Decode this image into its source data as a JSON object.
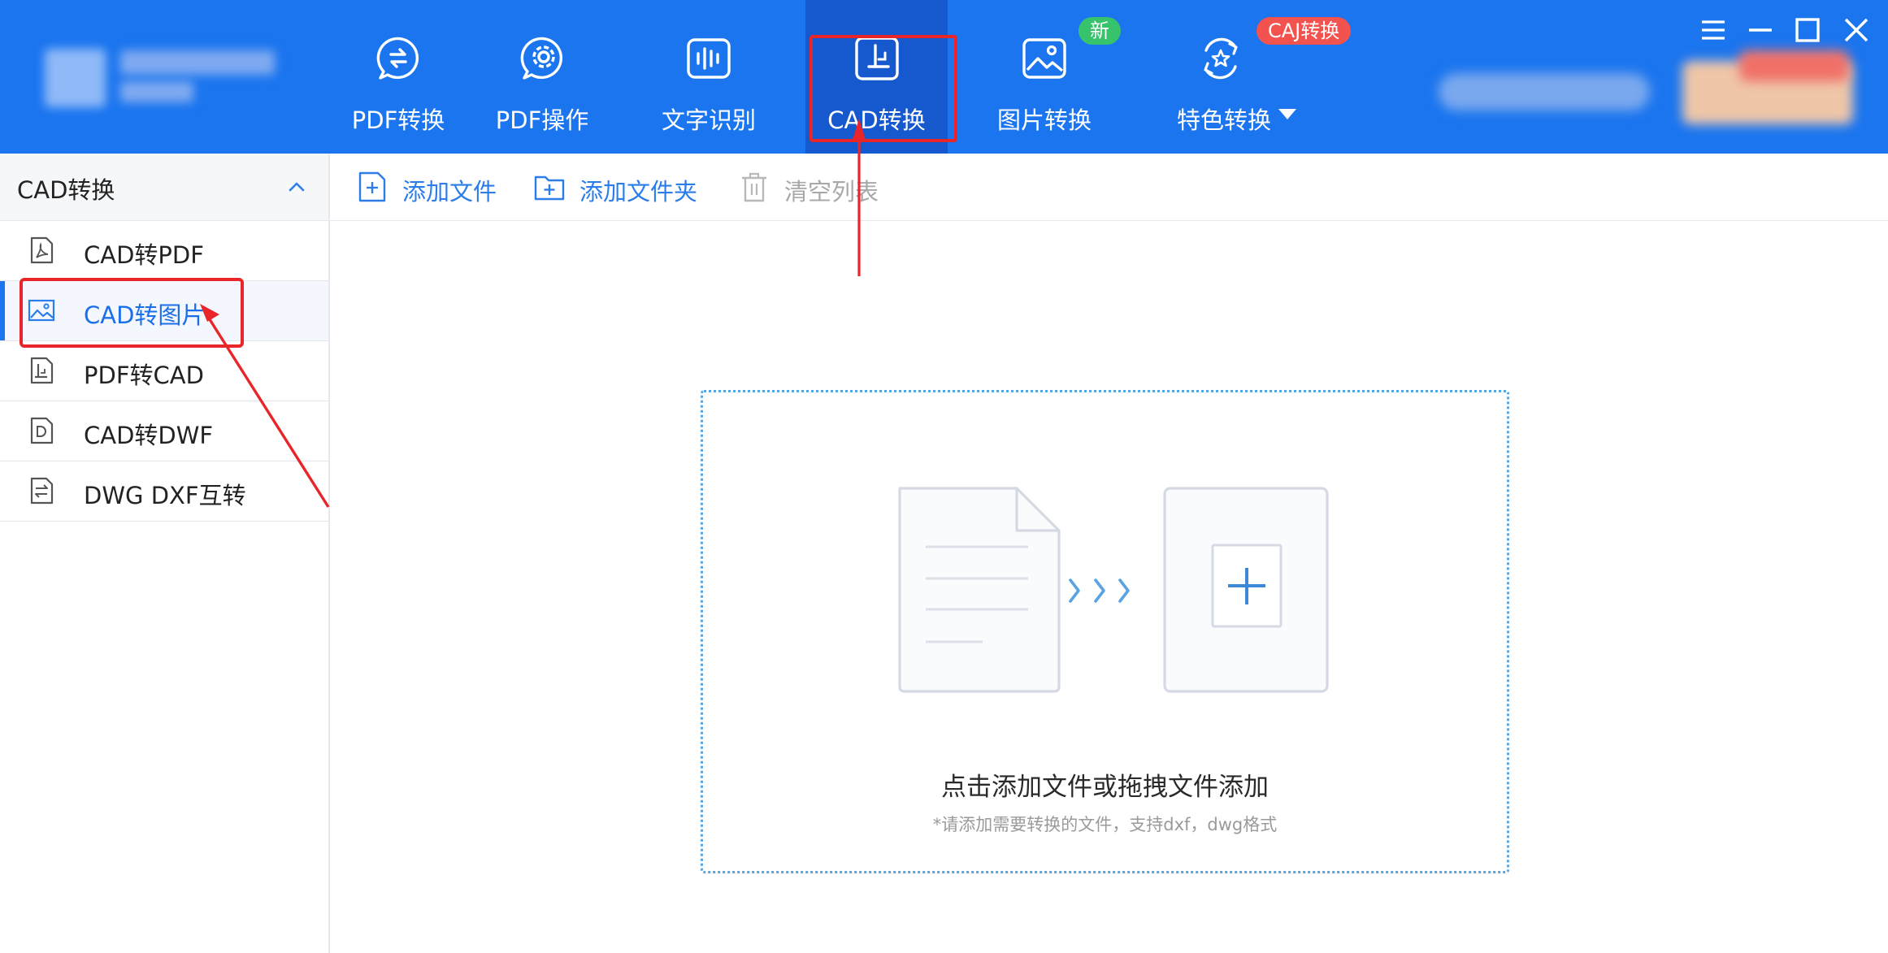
{
  "nav": {
    "items": [
      {
        "label": "PDF转换",
        "icon": "pdf-convert-icon"
      },
      {
        "label": "PDF操作",
        "icon": "pdf-operate-icon"
      },
      {
        "label": "文字识别",
        "icon": "text-recognition-icon"
      },
      {
        "label": "CAD转换",
        "icon": "cad-convert-icon",
        "active": true
      },
      {
        "label": "图片转换",
        "icon": "image-convert-icon"
      },
      {
        "label": "特色转换",
        "icon": "special-convert-icon"
      }
    ],
    "badge_new": "新",
    "badge_caj": "CAJ转换"
  },
  "sidebar": {
    "title": "CAD转换",
    "items": [
      {
        "label": "CAD转PDF",
        "icon": "pdf-file-icon"
      },
      {
        "label": "CAD转图片",
        "icon": "image-file-icon",
        "active": true
      },
      {
        "label": "PDF转CAD",
        "icon": "cad-file-icon"
      },
      {
        "label": "CAD转DWF",
        "icon": "dwf-file-icon"
      },
      {
        "label": "DWG DXF互转",
        "icon": "swap-file-icon"
      }
    ]
  },
  "toolbar": {
    "add_file": "添加文件",
    "add_folder": "添加文件夹",
    "clear_list": "清空列表"
  },
  "dropzone": {
    "main_text": "点击添加文件或拖拽文件添加",
    "hint_text": "*请添加需要转换的文件，支持dxf，dwg格式"
  },
  "colors": {
    "brand_blue": "#1b75ef",
    "active_nav": "#1659cf",
    "annotation_red": "#e8262a",
    "badge_green": "#36c36c",
    "badge_red": "#f2534f"
  }
}
